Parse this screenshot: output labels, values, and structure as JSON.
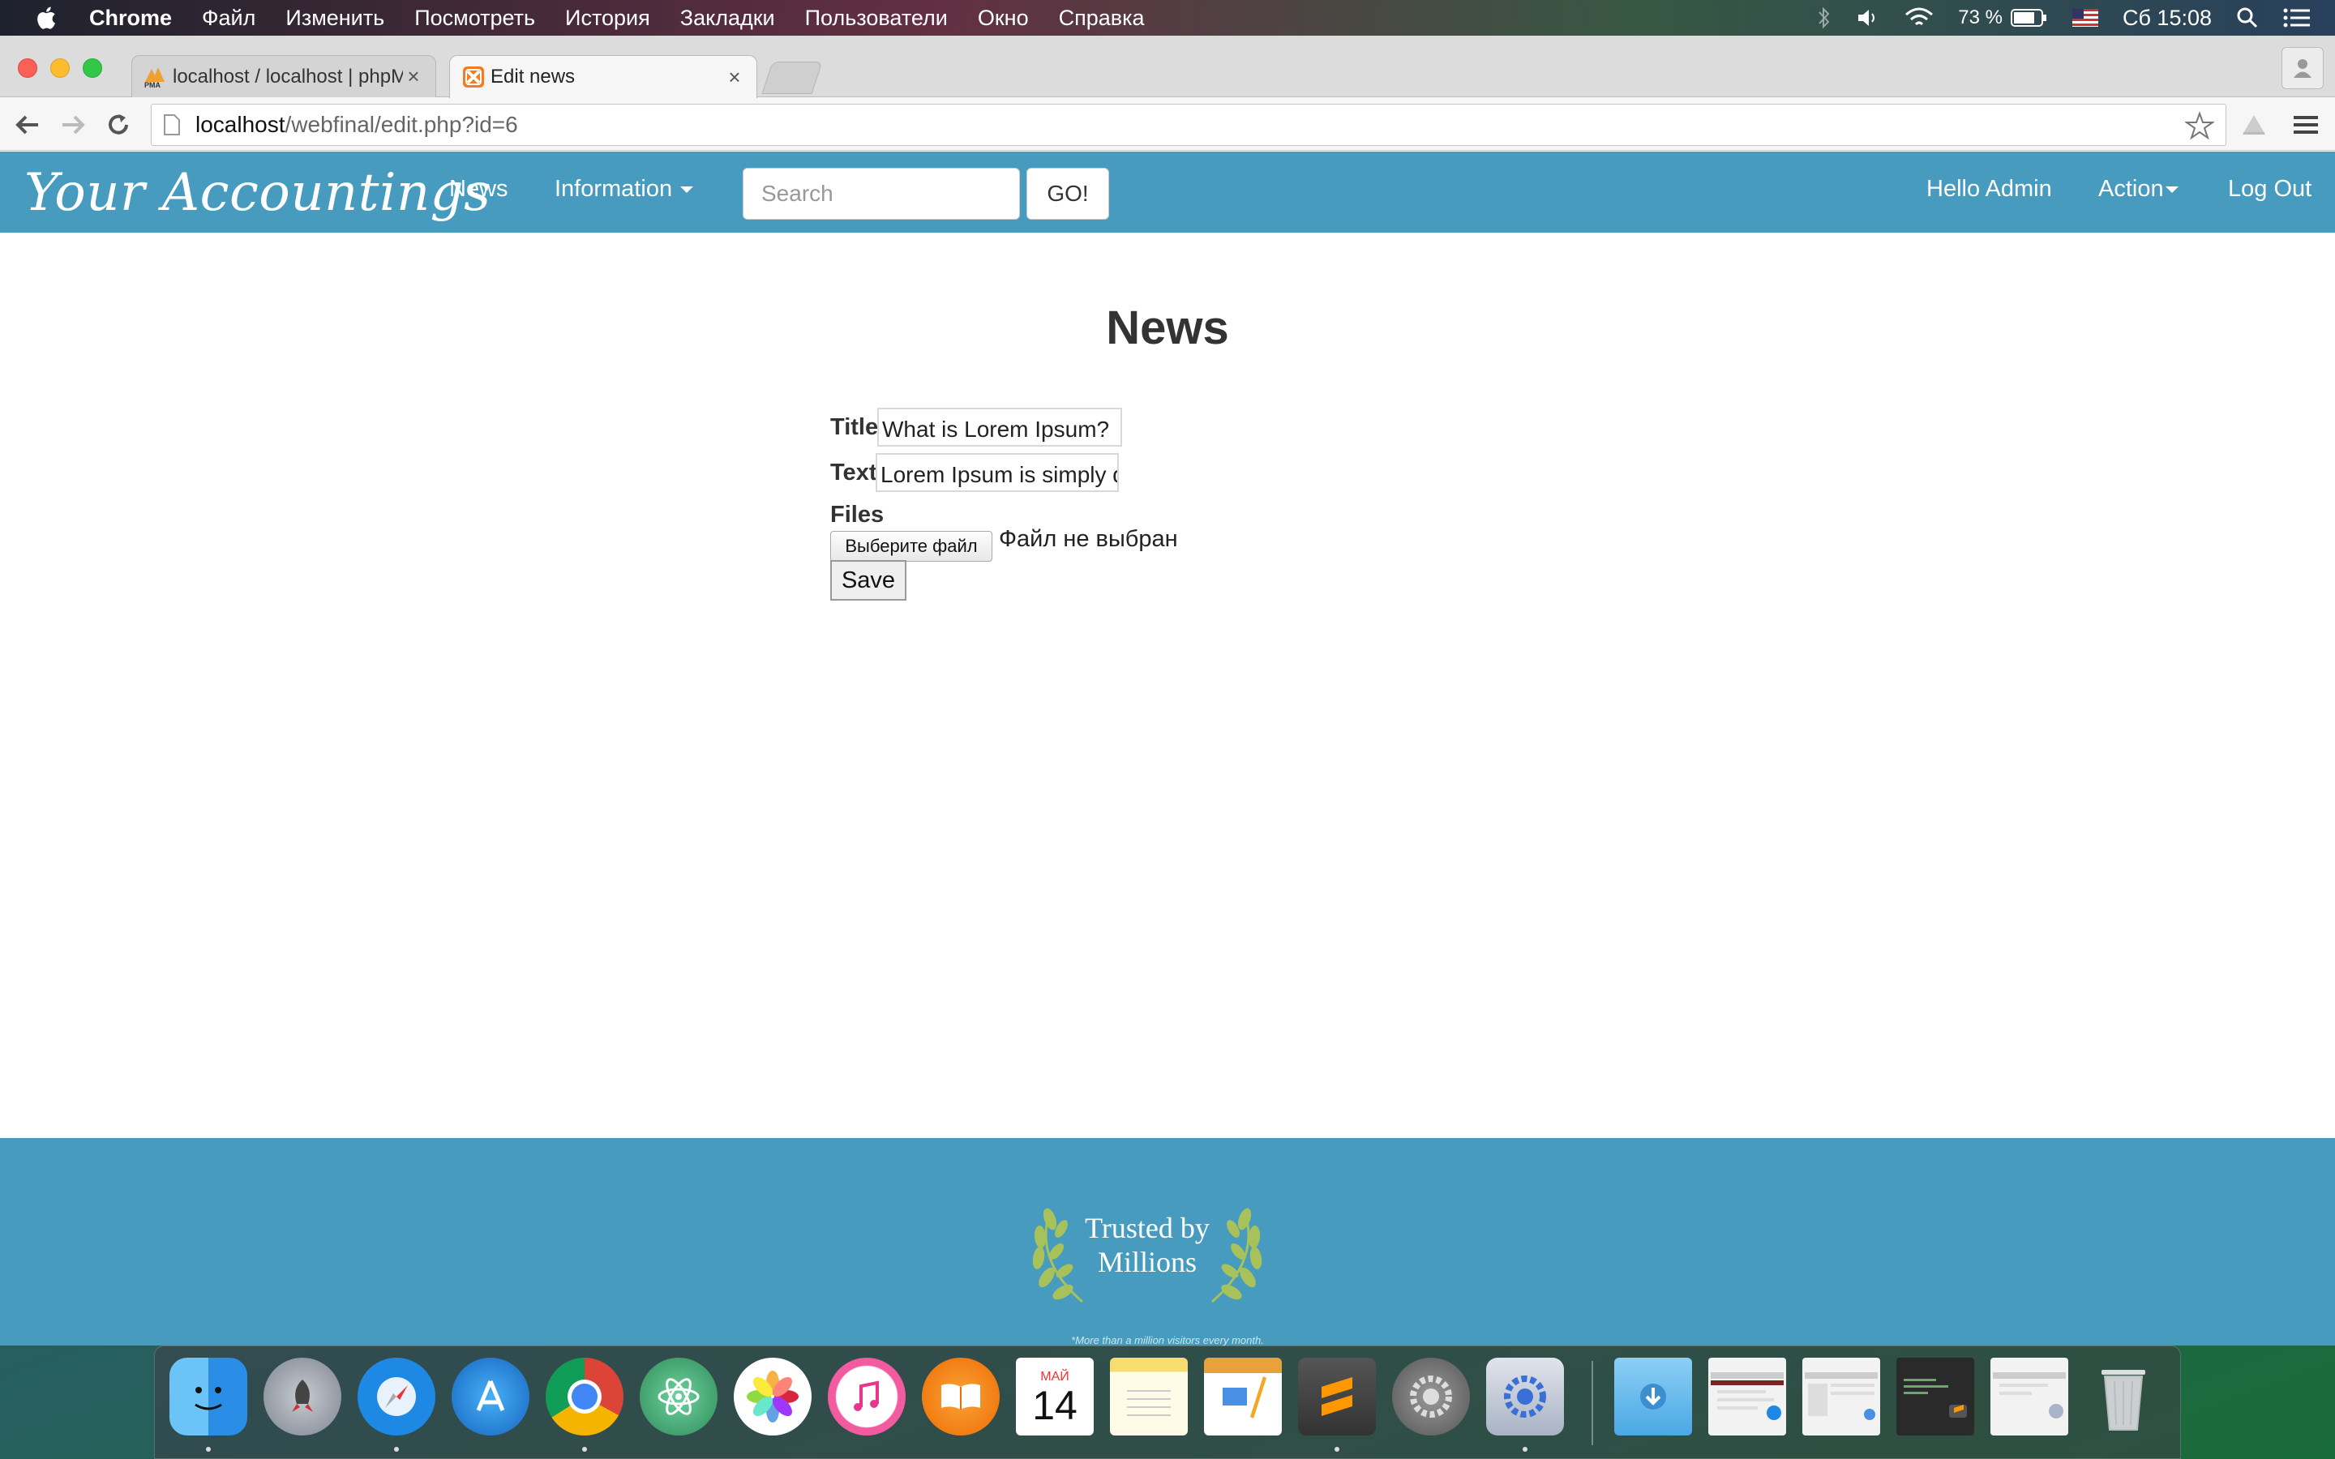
{
  "menubar": {
    "app_name": "Chrome",
    "items": [
      "Файл",
      "Изменить",
      "Посмотреть",
      "История",
      "Закладки",
      "Пользователи",
      "Окно",
      "Справка"
    ],
    "battery": "73 %",
    "clock": "Сб 15:08"
  },
  "browser": {
    "tabs": [
      {
        "title": "localhost / localhost | phpM",
        "icon": "phpmyadmin-icon",
        "favicon_text": "PMA"
      },
      {
        "title": "Edit news",
        "icon": "xampp-icon"
      }
    ],
    "url_host": "localhost",
    "url_path": "/webfinal/edit.php?id=6"
  },
  "navbar": {
    "brand": "Your Accountings",
    "news": "News",
    "information": "Information",
    "search_placeholder": "Search",
    "go": "GO!",
    "greeting": "Hello Admin",
    "action": "Action",
    "logout": "Log Out"
  },
  "form": {
    "heading": "News",
    "title_label": "Title",
    "title_value": "What is Lorem Ipsum?",
    "text_label": "Text",
    "text_value": "Lorem Ipsum is simply dummy text",
    "files_label": "Files",
    "file_button": "Выберите файл",
    "file_status": "Файл не выбран",
    "save": "Save"
  },
  "footer": {
    "trust_line1": "Trusted by",
    "trust_line2": "Millions",
    "trust_note": "*More than a million visitors every month."
  },
  "dock": {
    "calendar_month": "МАЙ",
    "calendar_day": "14",
    "apps": [
      "finder-icon",
      "launchpad-icon",
      "safari-icon",
      "app-store-icon",
      "chrome-icon",
      "atom-icon",
      "photos-icon",
      "itunes-icon",
      "ibooks-icon",
      "calendar-icon",
      "notes-icon",
      "pages-icon",
      "sublime-text-icon",
      "system-preferences-icon",
      "xampp-manager-icon",
      "downloads-folder-icon",
      "window-thumbnail-1",
      "window-thumbnail-2",
      "window-thumbnail-3",
      "window-thumbnail-4",
      "trash-icon"
    ]
  },
  "colors": {
    "navbar": "#469bbe",
    "footer": "#469bbe",
    "laurel": "#a7c25a"
  }
}
